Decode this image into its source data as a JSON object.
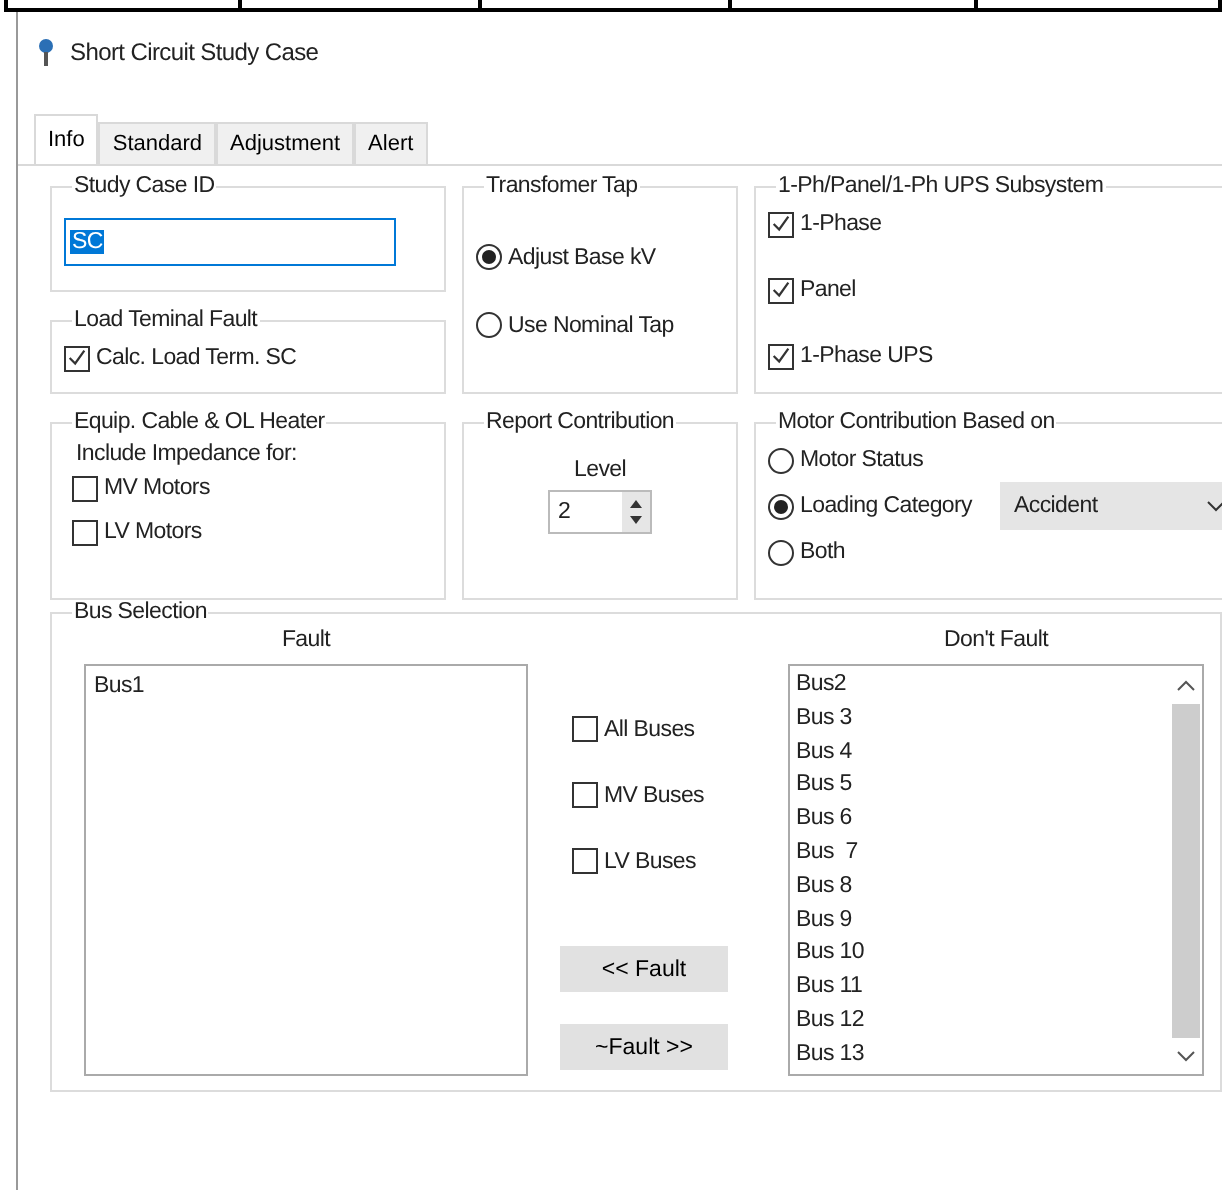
{
  "window": {
    "title": "Short Circuit Study Case"
  },
  "tabs": [
    {
      "label": "Info",
      "selected": true
    },
    {
      "label": "Standard",
      "selected": false
    },
    {
      "label": "Adjustment",
      "selected": false
    },
    {
      "label": "Alert",
      "selected": false
    }
  ],
  "study_case_id": {
    "title": "Study Case ID",
    "value": "SC"
  },
  "load_terminal_fault": {
    "title": "Load Teminal Fault",
    "options": [
      {
        "label": "Calc. Load Term. SC",
        "checked": true
      }
    ]
  },
  "transformer_tap": {
    "title": "Transfomer Tap",
    "options": [
      {
        "label": "Adjust Base kV",
        "selected": true
      },
      {
        "label": "Use Nominal Tap",
        "selected": false
      }
    ]
  },
  "subsystem": {
    "title": "1-Ph/Panel/1-Ph UPS Subsystem",
    "options": [
      {
        "label": "1-Phase",
        "checked": true
      },
      {
        "label": "Panel",
        "checked": true
      },
      {
        "label": "1-Phase UPS",
        "checked": true
      }
    ]
  },
  "equip_cable": {
    "title": "Equip. Cable & OL Heater",
    "subtitle": "Include Impedance for:",
    "options": [
      {
        "label": "MV Motors",
        "checked": false
      },
      {
        "label": "LV Motors",
        "checked": false
      }
    ]
  },
  "report_contribution": {
    "title": "Report Contribution",
    "label": "Level",
    "value": "2"
  },
  "motor_contribution": {
    "title": "Motor Contribution Based on",
    "options": [
      {
        "label": "Motor Status",
        "selected": false
      },
      {
        "label": "Loading Category",
        "selected": true
      },
      {
        "label": "Both",
        "selected": false
      }
    ],
    "dropdown": "Accident"
  },
  "bus_selection": {
    "title": "Bus Selection",
    "fault_label": "Fault",
    "dont_fault_label": "Don't Fault",
    "fault": [
      "Bus1"
    ],
    "filters": [
      {
        "label": "All Buses",
        "checked": false
      },
      {
        "label": "MV Buses",
        "checked": false
      },
      {
        "label": "LV Buses",
        "checked": false
      }
    ],
    "buttons": [
      "<< Fault",
      "~Fault >>"
    ],
    "dont_fault": [
      "Bus2",
      "Bus 3",
      "Bus 4",
      "Bus 5",
      "Bus 6",
      "Bus  7",
      "Bus 8",
      "Bus 9",
      "Bus 10",
      "Bus 11",
      "Bus 12",
      "Bus 13"
    ]
  }
}
